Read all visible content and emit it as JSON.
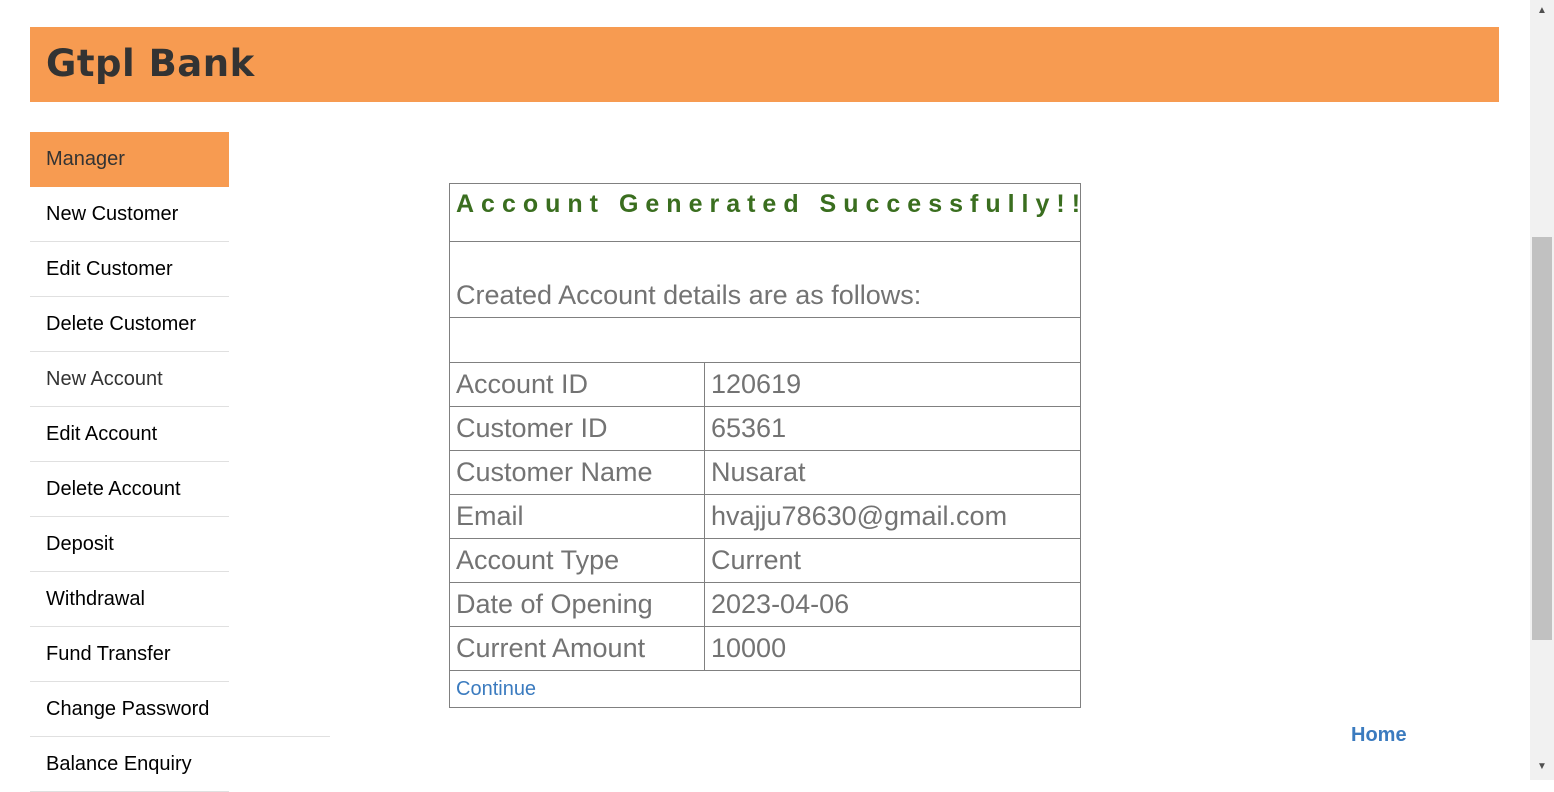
{
  "header": {
    "brand": "Gtpl Bank"
  },
  "sidebar": {
    "items": [
      {
        "label": "Manager"
      },
      {
        "label": "New Customer"
      },
      {
        "label": "Edit Customer"
      },
      {
        "label": "Delete Customer"
      },
      {
        "label": "New Account"
      },
      {
        "label": "Edit Account"
      },
      {
        "label": "Delete Account"
      },
      {
        "label": "Deposit"
      },
      {
        "label": "Withdrawal"
      },
      {
        "label": "Fund Transfer"
      },
      {
        "label": "Change Password"
      },
      {
        "label": "Balance Enquiry"
      }
    ]
  },
  "result": {
    "heading": "Account Generated Successfully!!!",
    "subheading": "Created Account details are as follows:",
    "rows": [
      {
        "label": "Account ID",
        "value": "120619"
      },
      {
        "label": "Customer ID",
        "value": "65361"
      },
      {
        "label": "Customer Name",
        "value": "Nusarat"
      },
      {
        "label": "Email",
        "value": "hvajju78630@gmail.com"
      },
      {
        "label": "Account Type",
        "value": "Current"
      },
      {
        "label": "Date of Opening",
        "value": "2023-04-06"
      },
      {
        "label": "Current Amount",
        "value": "10000"
      }
    ],
    "continue_label": "Continue"
  },
  "footer": {
    "home_label": "Home"
  },
  "scrollbar": {
    "up_icon": "triangle-up",
    "down_icon": "triangle-down"
  }
}
